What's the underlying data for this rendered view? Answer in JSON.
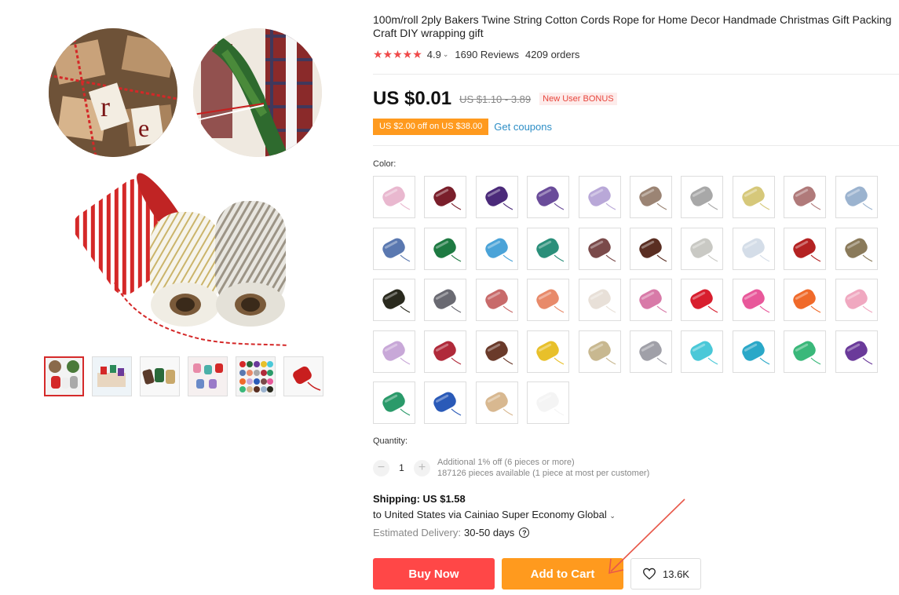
{
  "product": {
    "title": "100m/roll 2ply Bakers Twine String Cotton Cords Rope for Home Decor Handmade Christmas Gift Packing Craft DIY wrapping gift",
    "rating": "4.9",
    "reviews": "1690 Reviews",
    "orders": "4209 orders",
    "stars": "★★★★★"
  },
  "pricing": {
    "price": "US $0.01",
    "old_price": "US $1.10 - 3.89",
    "badge": "New User BONUS",
    "coupon": "US $2.00 off on US $38.00",
    "get_coupons": "Get coupons"
  },
  "color": {
    "label": "Color:",
    "swatches": [
      "#e9b8cf",
      "#7a1f2b",
      "#4b2a7a",
      "#6a4c9a",
      "#b9a8d8",
      "#9b8474",
      "#a8a8a8",
      "#d6c87a",
      "#b07a7a",
      "#9bb3cf",
      "#5a78b0",
      "#1e7a42",
      "#4aa3d8",
      "#2a8f7a",
      "#7a4a4a",
      "#5a2e22",
      "#c9c9c4",
      "#d4dde8",
      "#b42222",
      "#8a7a5a",
      "#2a2a1e",
      "#6a6a72",
      "#c86a6a",
      "#e88a6a",
      "#e8e0d8",
      "#d87aa8",
      "#d81e2e",
      "#e8589a",
      "#f06a2a",
      "#f0a8c0",
      "#c8a8d8",
      "#b02a3a",
      "#6a3a2a",
      "#e8c02a",
      "#c8b890",
      "#a0a0a8",
      "#4ac8d8",
      "#2aa8c8",
      "#3ab87a",
      "#6a3a9a",
      "#2a9a6a",
      "#2a5ab8",
      "#d8b890",
      "#f4f4f4"
    ]
  },
  "quantity": {
    "label": "Quantity:",
    "value": "1",
    "minus": "−",
    "plus": "+",
    "note1": "Additional 1% off (6 pieces or more)",
    "note2": "187126 pieces available (1 piece at most per customer)"
  },
  "shipping": {
    "title": "Shipping: US $1.58",
    "route": "to United States via Cainiao Super Economy Global",
    "route_chevron": "⌄",
    "delivery_label": "Estimated Delivery:",
    "delivery_value": "30-50 days",
    "help": "?"
  },
  "actions": {
    "buy_now": "Buy Now",
    "add_to_cart": "Add to Cart",
    "wishlist_count": "13.6K"
  },
  "icons": {
    "rating_chevron": "⌄",
    "heart": "heart-icon",
    "arrow": "annotation-arrow"
  },
  "colors": {
    "accent_red": "#ff4747",
    "accent_orange": "#ff9a1e",
    "link_blue": "#2d8ec6",
    "star_red": "#f04a4a"
  }
}
